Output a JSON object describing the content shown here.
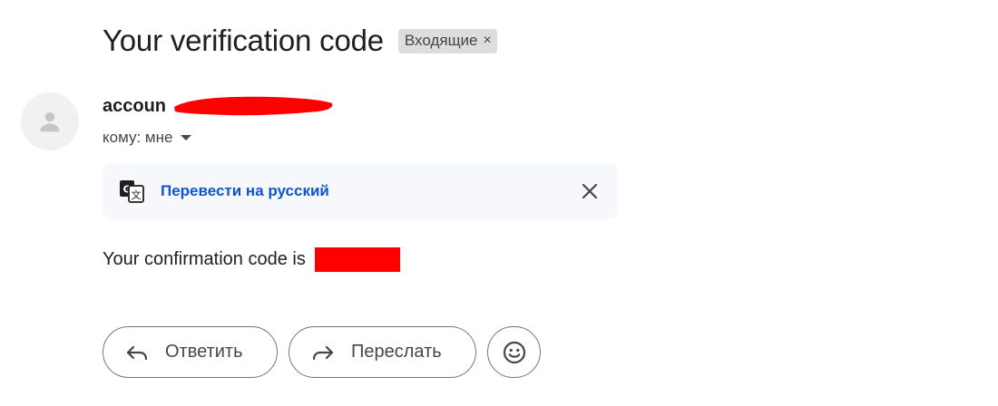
{
  "email": {
    "subject": "Your verification code",
    "label": "Входящие",
    "label_remove": "×",
    "sender": "accoun",
    "recipient": "кому: мне",
    "body": "Your confirmation code is"
  },
  "translate_bar": {
    "link": "Перевести на русский"
  },
  "actions": {
    "reply": "Ответить",
    "forward": "Переслать"
  },
  "icons": {
    "avatar": "person-icon",
    "translate": "translate-icon",
    "close": "close-icon",
    "reply": "reply-arrow-icon",
    "forward": "forward-arrow-icon",
    "emoji": "emoji-smile-icon"
  },
  "colors": {
    "link": "#0b57d0",
    "redaction": "#ff0000",
    "translate_bg": "#f6f8fc",
    "chip_bg": "#dddddd"
  }
}
